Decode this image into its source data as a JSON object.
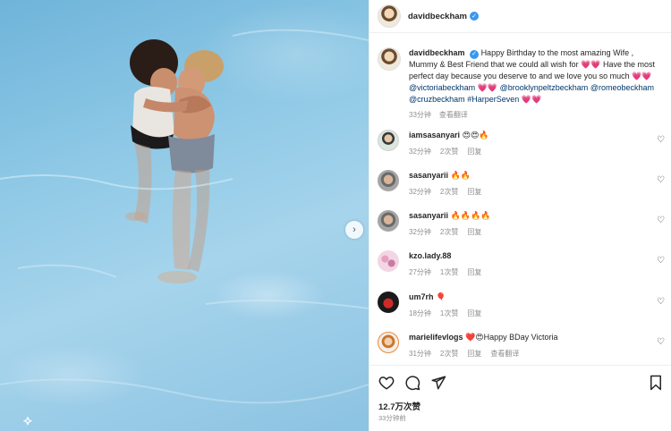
{
  "header": {
    "username": "davidbeckham"
  },
  "caption": {
    "username": "davidbeckham",
    "text_1": "Happy Birthday to the most amazing Wife , Mummy & Best Friend that we could all wish for",
    "hearts_1": "💗💗",
    "text_2": "Have the most perfect day because you deserve to and we love you so much",
    "hearts_2": "💗💗",
    "tag_1": "@victoriabeckham",
    "hearts_3": "💗💗",
    "tag_2": "@brooklynpeltzbeckham",
    "tag_3": "@romeobeckham",
    "tag_4": "@cruzbeckham",
    "tag_5": "#HarperSeven",
    "hearts_4": "💗💗",
    "time": "33分钟",
    "translate": "查看翻译"
  },
  "comments": [
    {
      "user": "iamsasanyari",
      "text": "😍😍🔥",
      "time": "32分钟",
      "likes": "2次赞",
      "reply": "回复",
      "translate": ""
    },
    {
      "user": "sasanyarii",
      "text": "🔥🔥",
      "time": "32分钟",
      "likes": "2次赞",
      "reply": "回复",
      "translate": ""
    },
    {
      "user": "sasanyarii",
      "text": "🔥🔥🔥🔥",
      "time": "32分钟",
      "likes": "2次赞",
      "reply": "回复",
      "translate": ""
    },
    {
      "user": "kzo.lady.88",
      "text": "",
      "time": "27分钟",
      "likes": "1次赞",
      "reply": "回复",
      "translate": ""
    },
    {
      "user": "um7rh",
      "text": "🎈",
      "time": "18分钟",
      "likes": "1次赞",
      "reply": "回复",
      "translate": ""
    },
    {
      "user": "marielifevlogs",
      "text": "❤️😍Happy BDay Victoria",
      "time": "31分钟",
      "likes": "2次赞",
      "reply": "回复",
      "translate": "查看翻译"
    }
  ],
  "footer": {
    "likes": "12.7万次赞",
    "time_ago": "33分钟前"
  },
  "colors": {
    "verified": "#3897f0",
    "link": "#00376b",
    "muted": "#8e8e8e"
  },
  "icons": [
    "verified-badge-icon",
    "heart-icon",
    "comment-icon",
    "share-icon",
    "save-icon",
    "chevron-right-icon"
  ]
}
